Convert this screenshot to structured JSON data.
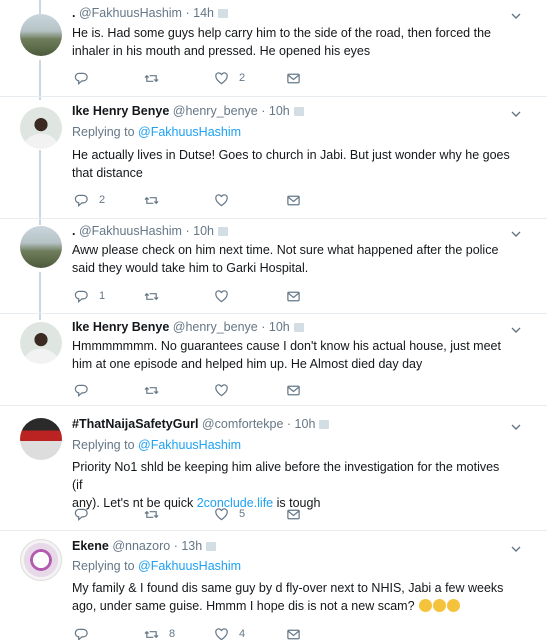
{
  "tweets": [
    {
      "name": ".",
      "handle": "@FakhuusHashim",
      "sep": "·",
      "time": "14h",
      "reply_label": "",
      "reply_mention": "",
      "text_lines": [
        "He is. Had some guys help carry him to the side of the road, then forced the",
        "inhaler in his mouth and pressed. He opened his eyes"
      ],
      "counts": {
        "reply": "",
        "retweet": "",
        "like": "2"
      }
    },
    {
      "name": "Ike Henry Benye",
      "handle": "@henry_benye",
      "sep": "·",
      "time": "10h",
      "reply_label": "Replying to",
      "reply_mention": "@FakhuusHashim",
      "text_lines": [
        "He actually lives in Dutse! Goes to church in Jabi. But just wonder why he goes",
        "that distance"
      ],
      "counts": {
        "reply": "2",
        "retweet": "",
        "like": ""
      }
    },
    {
      "name": ".",
      "handle": "@FakhuusHashim",
      "sep": "·",
      "time": "10h",
      "reply_label": "",
      "reply_mention": "",
      "text_lines": [
        "Aww please check on him next time. Not sure what happened after the police",
        "said they would take him to Garki Hospital."
      ],
      "counts": {
        "reply": "1",
        "retweet": "",
        "like": ""
      }
    },
    {
      "name": "Ike Henry Benye",
      "handle": "@henry_benye",
      "sep": "·",
      "time": "10h",
      "reply_label": "",
      "reply_mention": "",
      "text_lines": [
        "Hmmmmmmm. No guarantees cause I don't know his actual house, just meet",
        "him at one episode and helped him up. He Almost died day day"
      ],
      "counts": {
        "reply": "",
        "retweet": "",
        "like": ""
      }
    },
    {
      "name": "#ThatNaijaSafetyGurl",
      "handle": "@comfortekpe",
      "sep": "·",
      "time": "10h",
      "reply_label": "Replying to",
      "reply_mention": "@FakhuusHashim",
      "text_lines": [
        "Priority No1 shld be keeping him alive before the investigation for the motives (if",
        "any). Let's nt be quick "
      ],
      "text_link": "2conclude.life",
      "text_tail": " is tough",
      "counts": {
        "reply": "",
        "retweet": "",
        "like": "5"
      }
    },
    {
      "name": "Ekene",
      "handle": "@nnazoro",
      "sep": "·",
      "time": "13h",
      "reply_label": "Replying to",
      "reply_mention": "@FakhuusHashim",
      "text_lines": [
        "My family & I found dis same guy by d fly-over next to NHIS, Jabi a few weeks",
        "ago, under same guise. Hmmm I hope dis is not a new scam?"
      ],
      "counts": {
        "reply": "",
        "retweet": "8",
        "like": "4"
      }
    }
  ],
  "icons": {
    "reply": "reply-icon",
    "retweet": "retweet-icon",
    "like": "heart-icon",
    "dm": "envelope-icon",
    "more": "chevron-down-icon",
    "emoji": "thinking-face-emoji"
  },
  "colors": {
    "link": "#1da1f2",
    "muted": "#657786",
    "text": "#14171a",
    "divider": "#e6ecf0"
  }
}
